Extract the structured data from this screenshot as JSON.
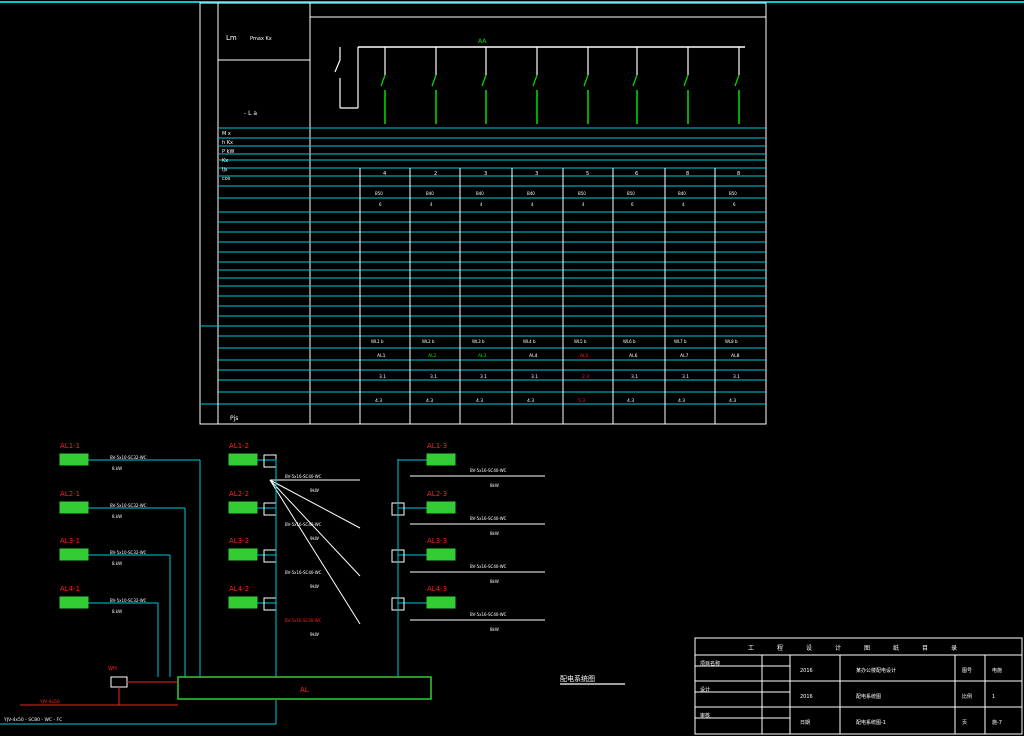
{
  "colors": {
    "background": "#000000",
    "white": "#ffffff",
    "cyan": "#00c8d8",
    "green": "#00e000",
    "panel_green": "#33cc33",
    "red": "#ff2020",
    "yellow": "#ffe000"
  },
  "panel": {
    "header_label": "Lm",
    "header_model": "Pmax Kx",
    "bus_label": "AA",
    "sub_label": "- L a",
    "info_rows": [
      "M x",
      "h Kx",
      "P kW",
      "Kx",
      "Ijs",
      "cos"
    ],
    "circuit_numbers": [
      "4",
      "2",
      "3",
      "3",
      "5",
      "6",
      "8",
      "8"
    ],
    "breaker_values": [
      "B50",
      "B40",
      "B40",
      "B40",
      "B50",
      "B50",
      "B40",
      "B50"
    ],
    "breaker_ratings": [
      "6",
      "4",
      "4",
      "4",
      "4",
      "6",
      "4",
      "6"
    ],
    "cable_specs": [
      "WL1 b",
      "WL2 b",
      "WL3 b",
      "WL4 b",
      "WL5 b",
      "WL6 b",
      "WL7 b",
      "WL8 b"
    ],
    "load_names": [
      "AL1",
      "AL2",
      "AL3",
      "AL4",
      "AL5",
      "AL6",
      "AL7",
      "AL8"
    ],
    "power_values": [
      "3.1",
      "3.1",
      "3.1",
      "3.1",
      "2.3",
      "3.1",
      "3.1",
      "3.1"
    ],
    "totals": [
      "4.3",
      "4.3",
      "4.3",
      "4.3",
      "5.3",
      "4.3",
      "4.3",
      "4.3"
    ],
    "summary_label": "Pjs"
  },
  "riser": {
    "left_panels": [
      "AL1-1",
      "AL2-1",
      "AL3-1",
      "AL4-1"
    ],
    "left_cables": [
      "BV-5x10-SC32-WC",
      "BV-5x10-SC32-WC",
      "BV-5x10-SC32-WC",
      "BV-5x10-SC32-WC"
    ],
    "left_kw": [
      "8.kW",
      "8.kW",
      "8.kW",
      "8.kW"
    ],
    "mid_panels": [
      "AL1-2",
      "AL2-2",
      "AL3-2",
      "AL4-2"
    ],
    "mid_cables": [
      "BV-5x16-SC40-WC",
      "BV-5x16-SC40-WC",
      "BV-5x16-SC40-WC",
      "BV-5x16-SC40-WC"
    ],
    "mid_kw": [
      "9kW",
      "9kW",
      "9kW",
      "9kW"
    ],
    "right_panels": [
      "AL1-3",
      "AL2-3",
      "AL3-3",
      "AL4-3"
    ],
    "right_cables": [
      "BV-5x16-SC40-WC",
      "BV-5x16-SC40-WC",
      "BV-5x16-SC40-WC",
      "BV-5x16-SC40-WC"
    ],
    "right_kw": [
      "8kW",
      "8kW",
      "8kW",
      "8kW"
    ],
    "main_box": "AL",
    "meter_label": "WH",
    "incoming": "YJV-4x50",
    "bottom_note": "YJV-4x50 - SC80 - WC - FC",
    "diagram_title": "配电系统图"
  },
  "titleblock": {
    "header": [
      "工",
      "程",
      "设",
      "计",
      "图",
      "纸",
      "目",
      "录"
    ],
    "rows": [
      {
        "a": "项目名称",
        "b": "",
        "c": "2016",
        "d": "某办公楼配电设计",
        "e": "图号",
        "f": "电施"
      },
      {
        "a": "设计",
        "b": "",
        "c": "2016",
        "d": "配电系统图",
        "e": "比例",
        "f": "1"
      },
      {
        "a": "审核",
        "b": "",
        "c": "日期",
        "d": "配电系统图-1",
        "e": "页",
        "f": "施-7"
      }
    ]
  }
}
